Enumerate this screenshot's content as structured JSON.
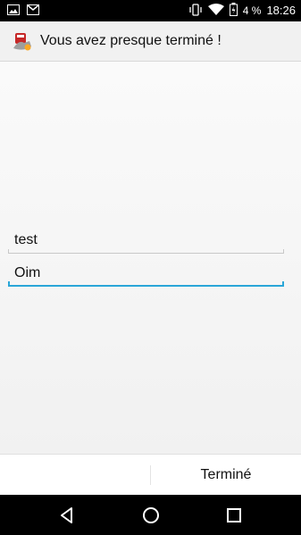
{
  "status_bar": {
    "left_icons": [
      "image-icon",
      "gmail-icon"
    ],
    "right_icons": [
      "vibrate-icon",
      "wifi-icon",
      "battery-icon"
    ],
    "battery_percent": "4 %",
    "time": "18:26"
  },
  "action_bar": {
    "app_icon": "app-logo-icon",
    "title": "Vous avez presque terminé !"
  },
  "form": {
    "field1_value": "test",
    "field2_value": "Oim"
  },
  "buttons": {
    "left_label": "",
    "done_label": "Terminé"
  },
  "nav_bar": {
    "icons": [
      "back-icon",
      "home-icon",
      "recents-icon"
    ]
  },
  "colors": {
    "accent": "#2aa6d8",
    "status_bar": "#000000",
    "action_bar": "#f1f1f1"
  }
}
